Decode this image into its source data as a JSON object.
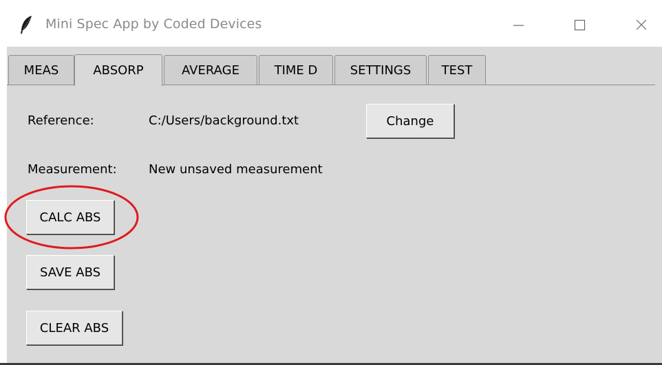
{
  "window": {
    "title": "Mini Spec App by Coded Devices",
    "icon": "feather-icon",
    "controls": [
      "minimize-icon",
      "maximize-icon",
      "close-icon"
    ]
  },
  "tabs": [
    {
      "label": "MEAS",
      "active": false
    },
    {
      "label": "ABSORP",
      "active": true
    },
    {
      "label": "AVERAGE",
      "active": false
    },
    {
      "label": "TIME D",
      "active": false
    },
    {
      "label": "SETTINGS",
      "active": false
    },
    {
      "label": "TEST",
      "active": false
    }
  ],
  "absorp": {
    "reference_label": "Reference:",
    "reference_value": "C:/Users/background.txt",
    "change_button": "Change",
    "measurement_label": "Measurement:",
    "measurement_value": "New unsaved measurement",
    "calc_button": "CALC ABS",
    "save_button": "SAVE ABS",
    "clear_button": "CLEAR ABS"
  },
  "annotation": {
    "color": "#e0191d",
    "target": "CALC ABS"
  }
}
